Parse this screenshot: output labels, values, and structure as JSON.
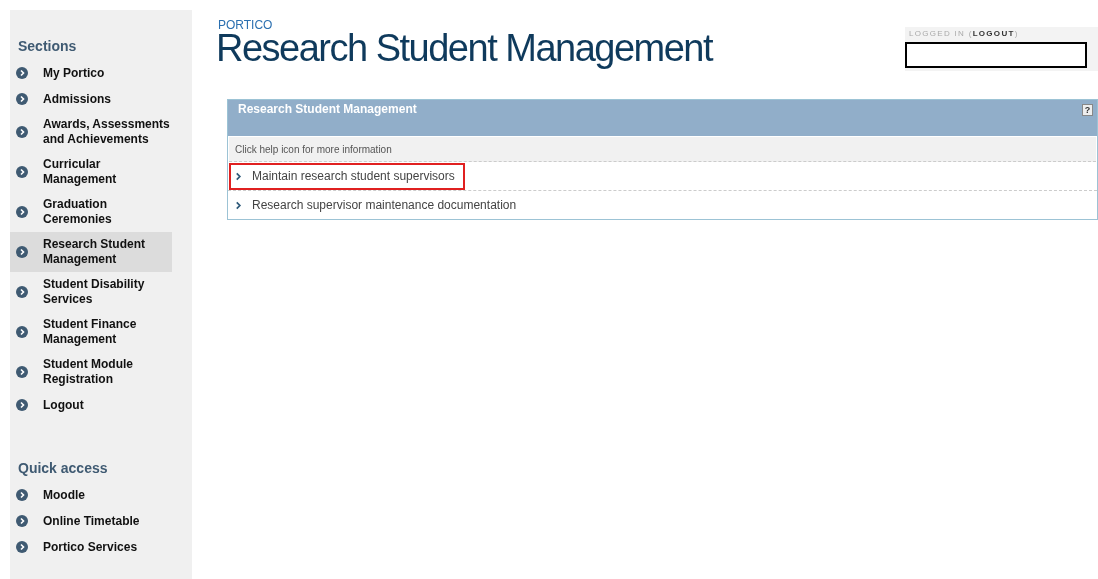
{
  "sidebar": {
    "sections_title": "Sections",
    "items": [
      {
        "label": "My Portico",
        "selected": false
      },
      {
        "label": "Admissions",
        "selected": false
      },
      {
        "label": "Awards, Assessments and Achievements",
        "selected": false
      },
      {
        "label": "Curricular Management",
        "selected": false
      },
      {
        "label": "Graduation Ceremonies",
        "selected": false
      },
      {
        "label": "Research Student Management",
        "selected": true
      },
      {
        "label": "Student Disability Services",
        "selected": false
      },
      {
        "label": "Student Finance Management",
        "selected": false
      },
      {
        "label": "Student Module Registration",
        "selected": false
      },
      {
        "label": "Logout",
        "selected": false
      }
    ],
    "quick_title": "Quick access",
    "quick_items": [
      {
        "label": "Moodle"
      },
      {
        "label": "Online Timetable"
      },
      {
        "label": "Portico Services"
      }
    ]
  },
  "header": {
    "brand": "PORTICO",
    "title": "Research Student Management"
  },
  "login": {
    "prefix": "LOGGED IN (",
    "link": "LOGOUT",
    "suffix": ")"
  },
  "panel": {
    "title": "Research Student Management",
    "help": "?",
    "hint": "Click help icon for more information",
    "links": [
      {
        "label": "Maintain research student supervisors",
        "highlighted": true
      },
      {
        "label": "Research supervisor maintenance documentation",
        "highlighted": false
      }
    ]
  }
}
